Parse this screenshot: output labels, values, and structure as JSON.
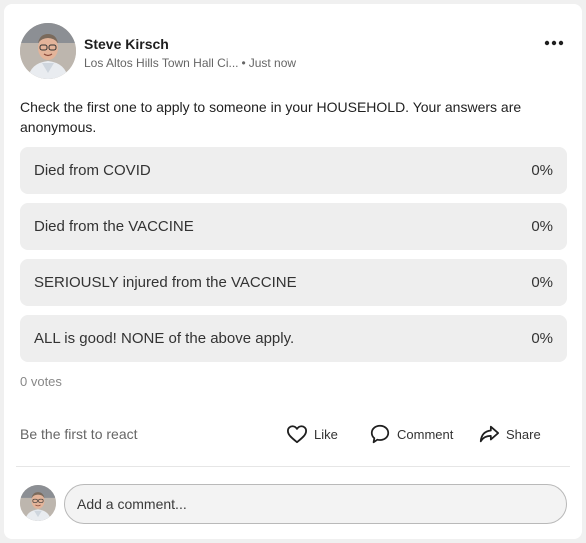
{
  "post": {
    "author": "Steve Kirsch",
    "location": "Los Altos Hills Town Hall Ci...",
    "separator": "•",
    "time": "Just now",
    "question": "Check the first one to apply to someone in your HOUSEHOLD. Your answers are anonymous."
  },
  "poll": {
    "options": [
      {
        "label": "Died from COVID",
        "percent": "0%"
      },
      {
        "label": "Died from the VACCINE",
        "percent": "0%"
      },
      {
        "label": "SERIOUSLY injured from the VACCINE",
        "percent": "0%"
      },
      {
        "label": "ALL is good! NONE of the above apply.",
        "percent": "0%"
      }
    ],
    "votes": "0 votes"
  },
  "reactions": {
    "prompt": "Be the first to react",
    "like_label": "Like",
    "comment_label": "Comment",
    "share_label": "Share"
  },
  "comment": {
    "placeholder": "Add a comment..."
  },
  "icons": [
    "more-icon",
    "like-icon",
    "comment-icon",
    "share-icon"
  ]
}
